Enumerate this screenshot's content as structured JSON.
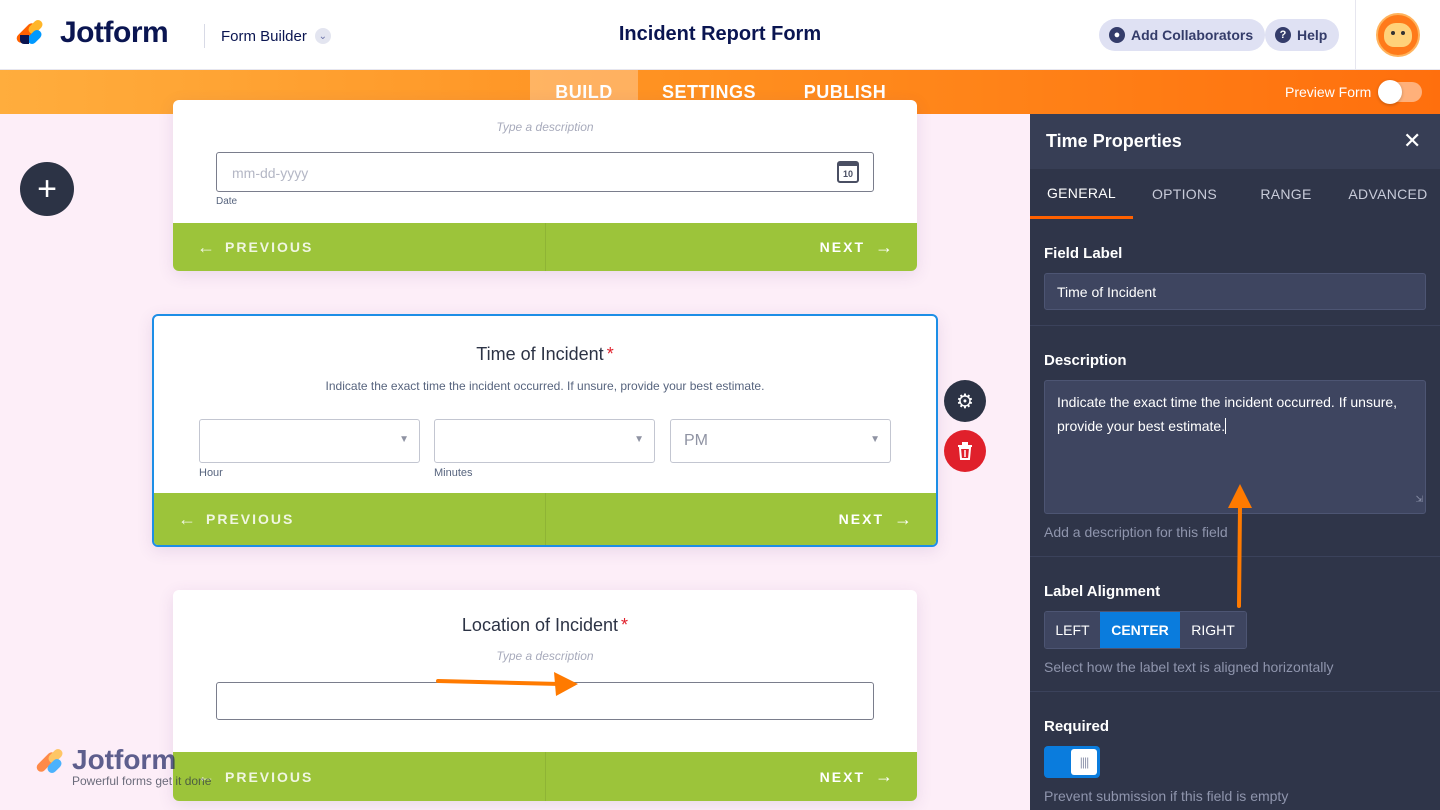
{
  "header": {
    "logo_text": "Jotform",
    "builder_label": "Form Builder",
    "form_title": "Incident Report Form",
    "add_collaborators_label": "Add Collaborators",
    "help_label": "Help"
  },
  "nav": {
    "tabs": [
      "BUILD",
      "SETTINGS",
      "PUBLISH"
    ],
    "active_tab": "BUILD",
    "preview_label": "Preview Form",
    "preview_on": false
  },
  "canvas": {
    "date_card": {
      "description_placeholder": "Type a description",
      "input_placeholder": "mm-dd-yyyy",
      "sub_label": "Date",
      "calendar_day": "10",
      "previous_label": "PREVIOUS",
      "next_label": "NEXT"
    },
    "time_card": {
      "title": "Time of Incident",
      "required_mark": "*",
      "description": "Indicate the exact time the incident occurred. If unsure, provide your best estimate.",
      "hour_value": "",
      "minutes_value": "",
      "ampm_value": "PM",
      "hour_label": "Hour",
      "minutes_label": "Minutes",
      "previous_label": "PREVIOUS",
      "next_label": "NEXT"
    },
    "location_card": {
      "title": "Location of Incident",
      "required_mark": "*",
      "description_placeholder": "Type a description",
      "previous_label": "PREVIOUS",
      "next_label": "NEXT"
    }
  },
  "panel": {
    "title": "Time Properties",
    "tabs": [
      "GENERAL",
      "OPTIONS",
      "RANGE",
      "ADVANCED"
    ],
    "active_tab": "GENERAL",
    "field_label_title": "Field Label",
    "field_label_value": "Time of Incident",
    "description_title": "Description",
    "description_value": "Indicate the exact time the incident occurred. If unsure, provide your best estimate.",
    "description_hint": "Add a description for this field",
    "alignment_title": "Label Alignment",
    "alignment_options": [
      "LEFT",
      "CENTER",
      "RIGHT"
    ],
    "alignment_selected": "CENTER",
    "alignment_hint": "Select how the label text is aligned horizontally",
    "required_title": "Required",
    "required_on": true,
    "required_hint": "Prevent submission if this field is empty"
  },
  "watermark": {
    "text": "Jotform",
    "tagline": "Powerful forms get it done"
  },
  "colors": {
    "brand_navy": "#0a1551",
    "nav_orange": "#ff8f1f",
    "footer_green": "#9cc43a",
    "selection_blue": "#1d8ee6",
    "panel_bg": "#2f3549",
    "delete_red": "#e0202b",
    "annotation_orange": "#ff7a00"
  }
}
